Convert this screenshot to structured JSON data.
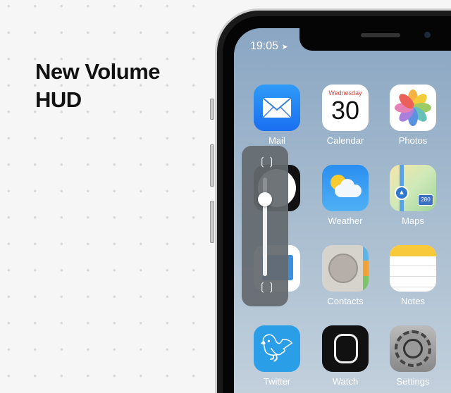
{
  "heading": {
    "line1": "New Volume",
    "line2": "HUD"
  },
  "status_bar": {
    "time": "19:05",
    "location_icon": "location-arrow-icon"
  },
  "apps": [
    {
      "label": "Mail",
      "icon": "mail-icon"
    },
    {
      "label": "Calendar",
      "icon": "calendar-icon",
      "weekday": "Wednesday",
      "day": "30"
    },
    {
      "label": "Photos",
      "icon": "photos-icon"
    },
    {
      "label": "Weather",
      "icon": "weather-icon"
    },
    {
      "label": "Maps",
      "icon": "maps-icon",
      "shield": "280"
    },
    {
      "label": "Contacts",
      "icon": "contacts-icon"
    },
    {
      "label": "Notes",
      "icon": "notes-icon"
    },
    {
      "label": "Twitter",
      "icon": "twitter-icon"
    },
    {
      "label": "Watch",
      "icon": "watch-icon"
    },
    {
      "label": "Settings",
      "icon": "settings-icon"
    }
  ],
  "volume_hud": {
    "level": 0.78,
    "top_icon": "airpods-icon",
    "bottom_icon": "airpods-muted-icon"
  },
  "colors": {
    "screen": "#8aa6c3",
    "hud": "#64696e"
  }
}
